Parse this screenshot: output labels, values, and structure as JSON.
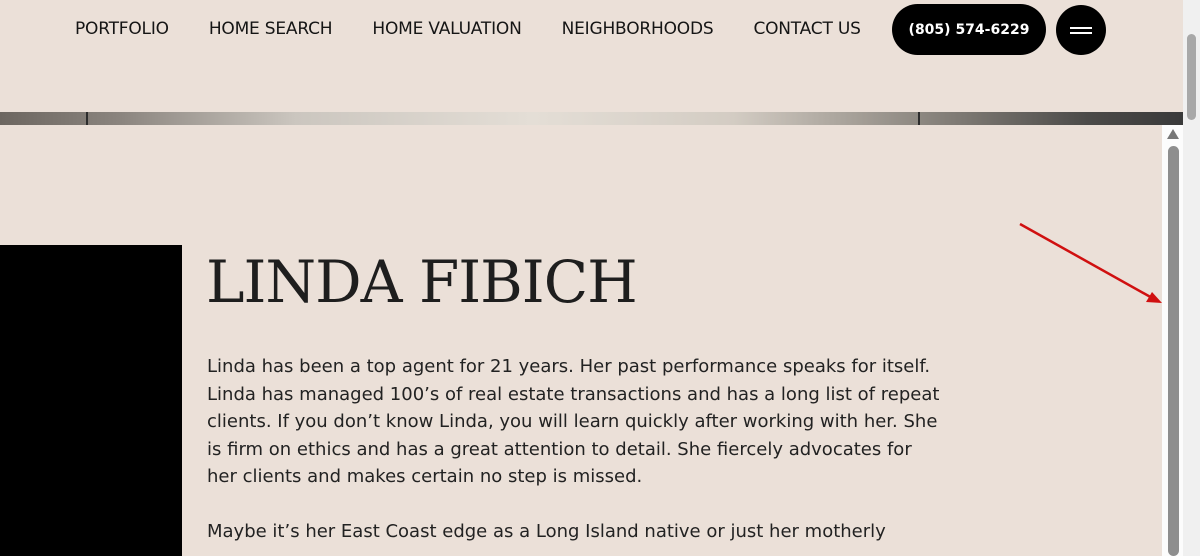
{
  "nav": {
    "items": [
      {
        "label": "PORTFOLIO"
      },
      {
        "label": "HOME SEARCH"
      },
      {
        "label": "HOME VALUATION"
      },
      {
        "label": "NEIGHBORHOODS"
      },
      {
        "label": "CONTACT US"
      }
    ],
    "phone": "(805) 574-6229",
    "menu_icon": "hamburger-icon"
  },
  "agent": {
    "name": "LINDA FIBICH",
    "bio_paragraph_1": "Linda has been a top agent for 21 years. Her past performance speaks for itself. Linda has managed 100’s of real estate transactions and has a long list of repeat clients. If you don’t know Linda, you will learn quickly after working with her. She is firm on ethics and has a great attention to detail. She fiercely advocates for her clients and makes certain no step is missed.",
    "bio_paragraph_2": "Maybe it’s her East Coast edge as a Long Island native or just her motherly"
  },
  "annotation": {
    "color": "#d01010"
  },
  "colors": {
    "background": "#ebe0d8",
    "button": "#000000"
  }
}
